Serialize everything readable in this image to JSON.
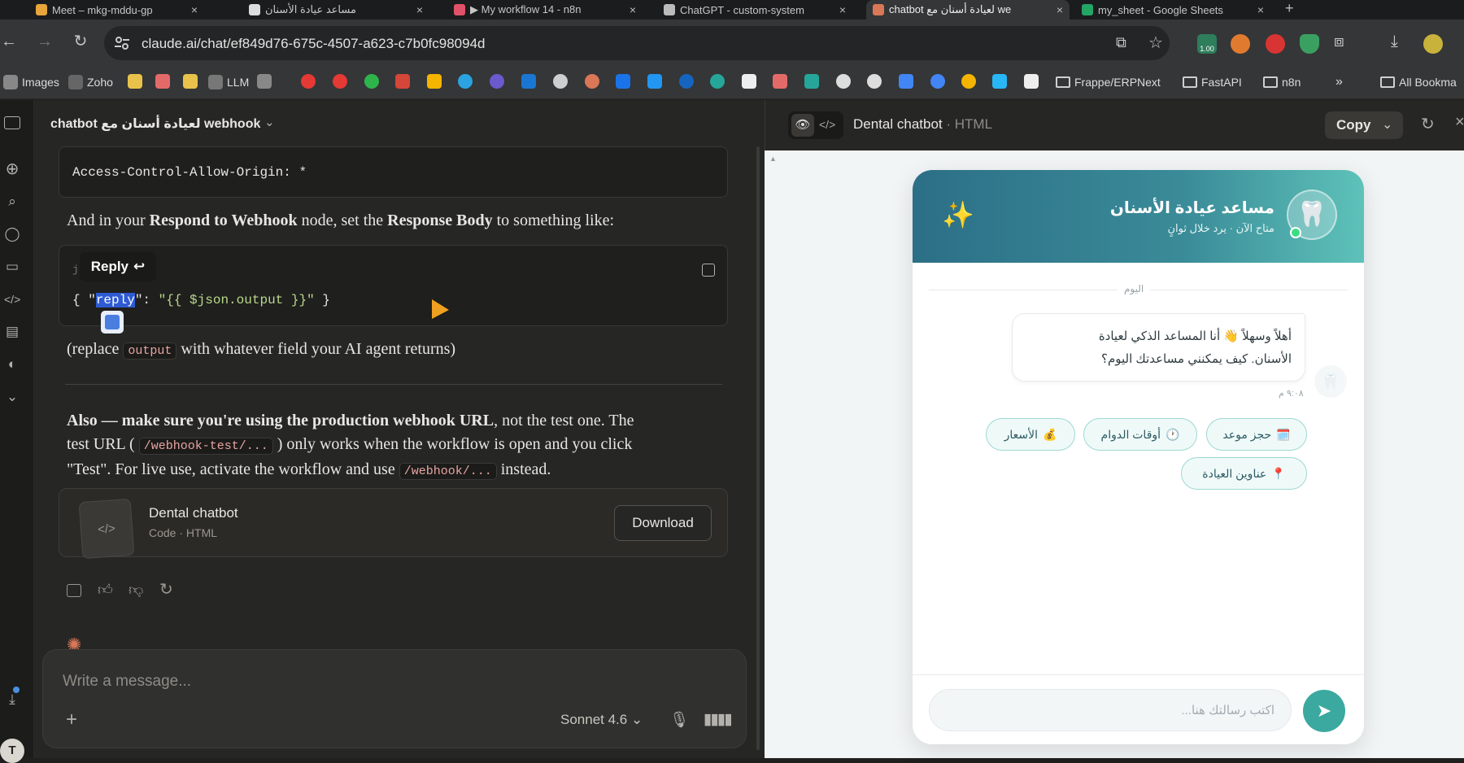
{
  "browser": {
    "tabs": [
      {
        "title": "Meet – mkg-mddu-gp",
        "color": "#e8a53a"
      },
      {
        "title": "مساعد عيادة الأسنان",
        "color": "#dddddd"
      },
      {
        "title": "▶ My workflow 14 - n8n",
        "color": "#e05268"
      },
      {
        "title": "ChatGPT - custom-system",
        "color": "#bbbbbb"
      },
      {
        "title": "chatbot لعيادة أسنان مع we",
        "color": "#d97757"
      },
      {
        "title": "my_sheet - Google Sheets",
        "color": "#23a566"
      }
    ],
    "url": "claude.ai/chat/ef849d76-675c-4507-a623-c7b0fc98094d",
    "extension_badge": "1.00",
    "bookmarks": [
      {
        "label": "Images"
      },
      {
        "label": "Zoho"
      },
      {
        "label": "LLM"
      },
      {
        "label": "Frappe/ERPNext"
      },
      {
        "label": "FastAPI"
      },
      {
        "label": "n8n"
      },
      {
        "label": "All Bookma"
      }
    ],
    "bookmarks_overflow": "»"
  },
  "chat": {
    "title": "chatbot لعيادة أسنان مع webhook",
    "code1": "Access-Control-Allow-Origin: *",
    "p1": {
      "a": "And in your ",
      "b": "Respond to Webhook",
      "c": " node, set the ",
      "d": "Response Body",
      "e": " to something like:"
    },
    "code2": {
      "lang": "js",
      "open": "{ \"",
      "key": "reply",
      "mid": "\": ",
      "value": "\"{{ $json.output }}\"",
      "close": " }"
    },
    "reply_tooltip": "Reply",
    "p2": {
      "a": "(replace ",
      "code": "output",
      "b": " with whatever field your AI agent returns)"
    },
    "p3": {
      "bold": "Also — make sure you're using the production webhook URL",
      "a": ", not the test one. The",
      "b": "test URL (",
      "code1": "/webhook-test/...",
      "c": ") only works when the workflow is open and you click",
      "d": "\"Test\". For live use, activate the workflow and use ",
      "code2": "/webhook/...",
      "e": " instead."
    },
    "artifact": {
      "title": "Dental chatbot",
      "subtitle": "Code · HTML",
      "download": "Download"
    },
    "composer": {
      "placeholder": "Write a message...",
      "model": "Sonnet 4.6"
    },
    "avatar": "T"
  },
  "preview": {
    "title": "Dental chatbot",
    "type": "HTML",
    "copy": "Copy",
    "bot": {
      "name": "مساعد عيادة الأسنان",
      "status": "متاح الآن · يرد خلال ثوانٍ",
      "day": "اليوم",
      "greeting_line1": "أهلاً وسهلاً 👋 أنا المساعد الذكي لعيادة",
      "greeting_line2": "الأسنان. كيف يمكنني مساعدتك اليوم؟",
      "time": "٩:٠٨ م",
      "chips": [
        {
          "label": "حجز موعد",
          "emoji": "🗓️"
        },
        {
          "label": "أوقات الدوام",
          "emoji": "🕐"
        },
        {
          "label": "الأسعار",
          "emoji": "💰"
        },
        {
          "label": "عناوين العيادة",
          "emoji": "📍"
        }
      ],
      "input_placeholder": "اكتب رسالتك هنا...",
      "sparkle": "✨",
      "tooth": "🦷"
    },
    "colors": {
      "header_start": "#2c6f87",
      "header_end": "#5ec2b9",
      "accent": "#3ba9a0"
    }
  }
}
